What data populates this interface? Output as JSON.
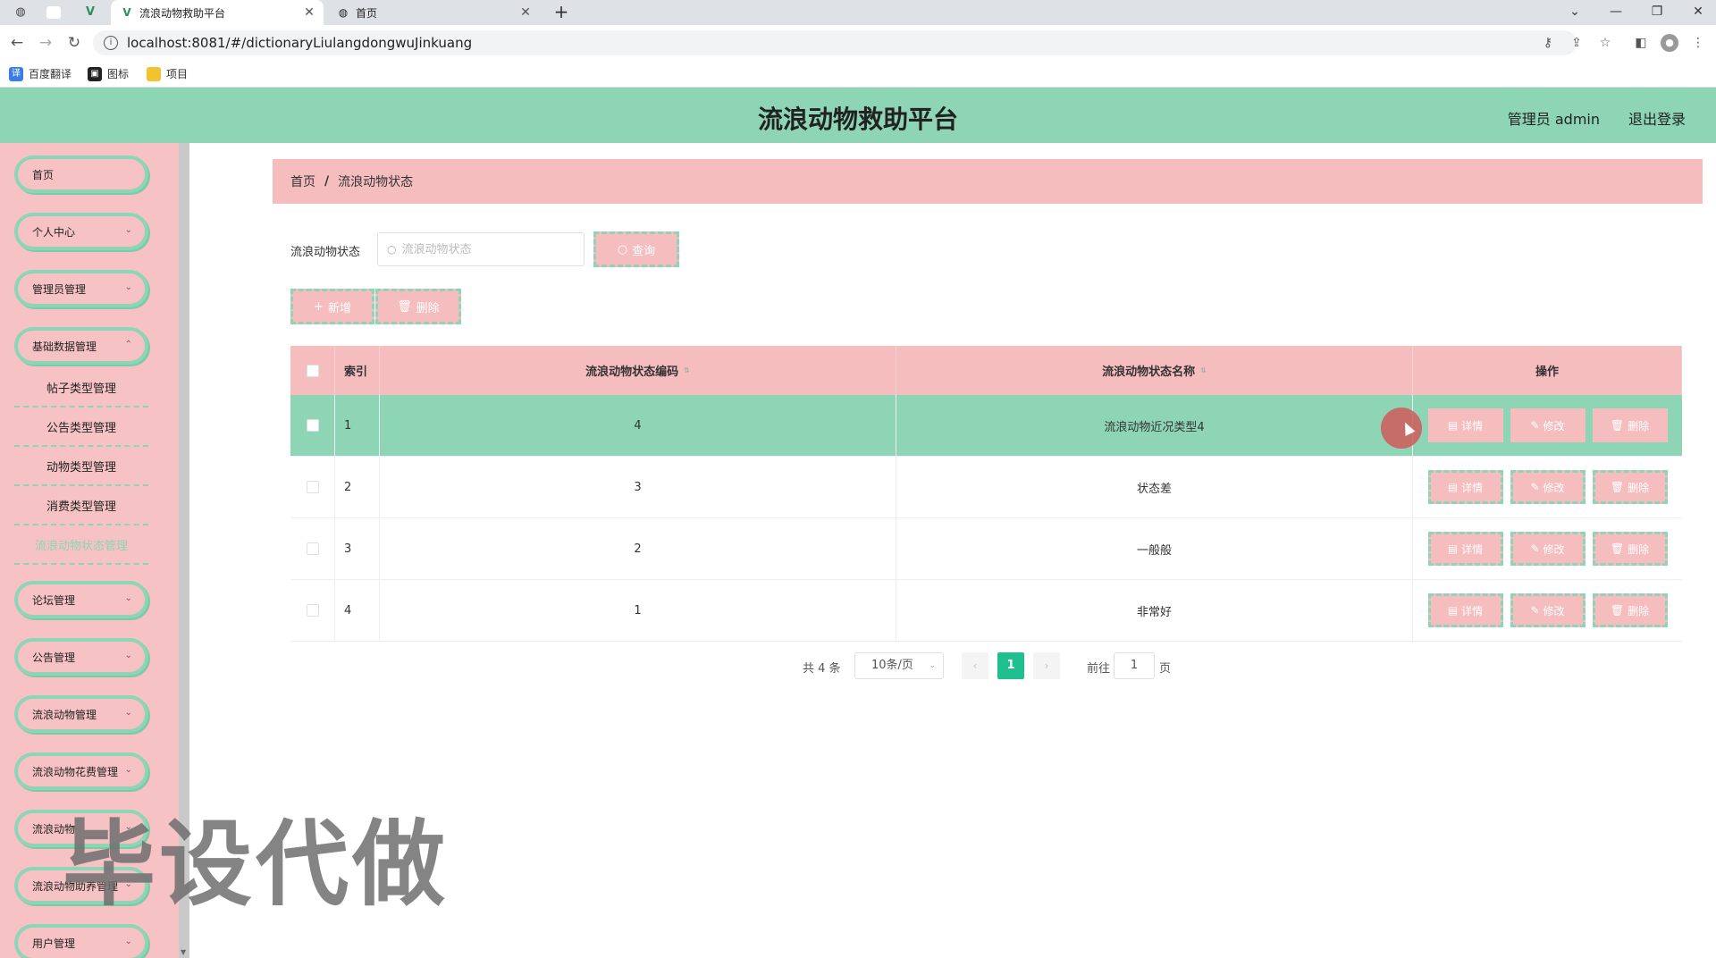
{
  "browser": {
    "tabs": [
      {
        "title": "流浪动物救助平台",
        "active": true
      },
      {
        "title": "首页",
        "active": false
      }
    ],
    "url": "localhost:8081/#/dictionaryLiulangdongwuJinkuang",
    "bookmarks": [
      "百度翻译",
      "图标",
      "项目"
    ]
  },
  "header": {
    "title": "流浪动物救助平台",
    "user": "管理员 admin",
    "logout": "退出登录"
  },
  "sidebar": {
    "menus": [
      {
        "label": "首页"
      },
      {
        "label": "个人中心"
      },
      {
        "label": "管理员管理"
      },
      {
        "label": "基础数据管理"
      },
      {
        "label": "论坛管理"
      },
      {
        "label": "公告管理"
      },
      {
        "label": "流浪动物管理"
      },
      {
        "label": "流浪动物花费管理"
      },
      {
        "label": "流浪动物"
      },
      {
        "label": "流浪动物助养管理"
      },
      {
        "label": "用户管理"
      }
    ],
    "submenu": [
      {
        "label": "帖子类型管理"
      },
      {
        "label": "公告类型管理"
      },
      {
        "label": "动物类型管理"
      },
      {
        "label": "消费类型管理"
      },
      {
        "label": "流浪动物状态管理"
      }
    ]
  },
  "breadcrumb": {
    "home": "首页",
    "sep": "/",
    "current": "流浪动物状态"
  },
  "search": {
    "label": "流浪动物状态",
    "placeholder": "流浪动物状态",
    "query_button": "查询"
  },
  "toolbar": {
    "add_button": "新增",
    "delete_button": "删除"
  },
  "table": {
    "headers": {
      "index": "索引",
      "code": "流浪动物状态编码",
      "name": "流浪动物状态名称",
      "ops": "操作"
    },
    "rows": [
      {
        "index": "1",
        "code": "4",
        "name": "流浪动物近况类型4"
      },
      {
        "index": "2",
        "code": "3",
        "name": "状态差"
      },
      {
        "index": "3",
        "code": "2",
        "name": "一般般"
      },
      {
        "index": "4",
        "code": "1",
        "name": "非常好"
      }
    ],
    "op_labels": {
      "detail": "详情",
      "edit": "修改",
      "delete": "删除"
    }
  },
  "pagination": {
    "total": "共 4 条",
    "page_size": "10条/页",
    "current": "1",
    "goto_label": "前往",
    "goto_value": "1",
    "page_suffix": "页"
  },
  "watermark": "毕设代做",
  "colors": {
    "mint": "#8dd5b5",
    "pink": "#f6bdbf",
    "active_page": "#1fbf8f"
  }
}
